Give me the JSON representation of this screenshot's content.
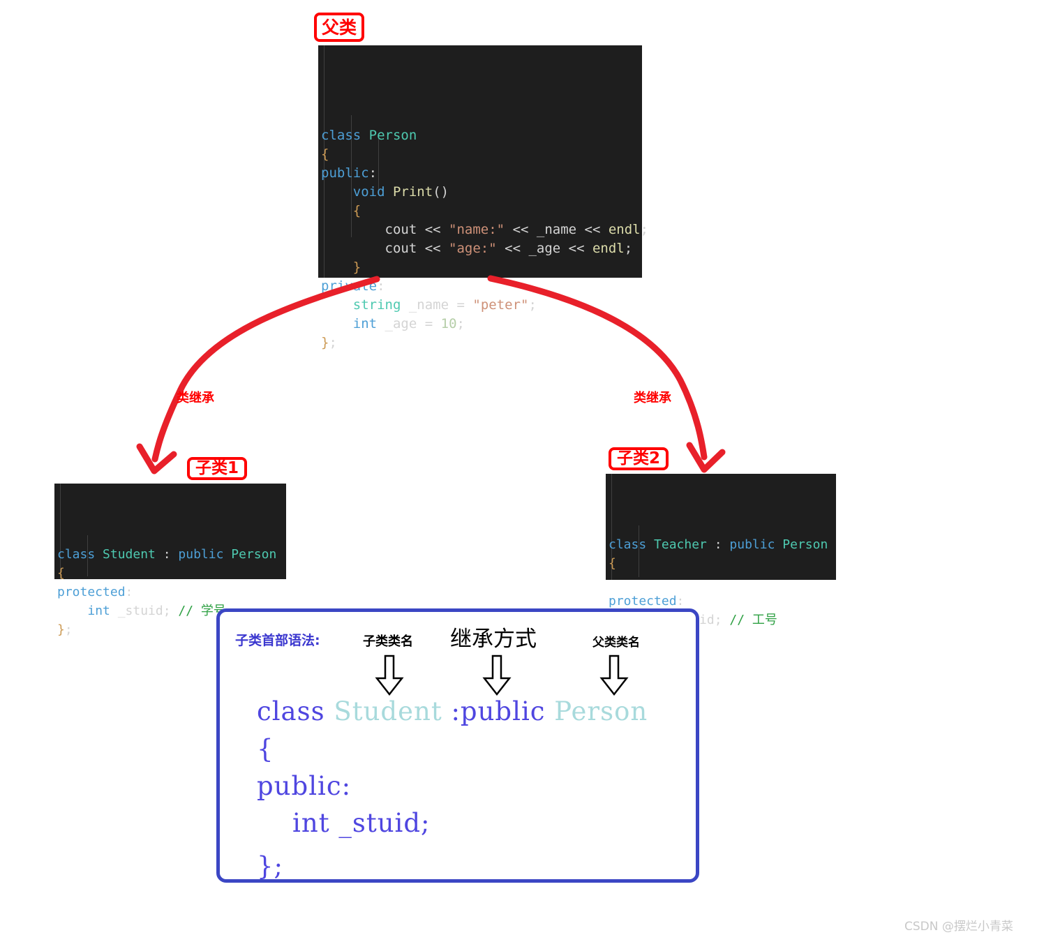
{
  "badges": {
    "parent": "父类",
    "child1": "子类1",
    "child2": "子类2"
  },
  "arrow_labels": {
    "left": "类继承",
    "right": "类继承"
  },
  "parent_code": {
    "title": "class Person",
    "lines": [
      [
        {
          "t": "class",
          "c": "kw"
        },
        {
          "t": " ",
          "c": "punc"
        },
        {
          "t": "Person",
          "c": "type"
        }
      ],
      [
        {
          "t": "{",
          "c": "brace"
        }
      ],
      [
        {
          "t": "public",
          "c": "kw"
        },
        {
          "t": ":",
          "c": "punc"
        }
      ],
      [
        {
          "t": "    ",
          "c": "punc"
        },
        {
          "t": "void",
          "c": "kw"
        },
        {
          "t": " ",
          "c": "punc"
        },
        {
          "t": "Print",
          "c": "fn"
        },
        {
          "t": "()",
          "c": "punc"
        }
      ],
      [
        {
          "t": "    ",
          "c": "punc"
        },
        {
          "t": "{",
          "c": "brace"
        }
      ],
      [
        {
          "t": "        ",
          "c": "punc"
        },
        {
          "t": "cout",
          "c": "punc"
        },
        {
          "t": " << ",
          "c": "op"
        },
        {
          "t": "\"name:\"",
          "c": "str"
        },
        {
          "t": " << ",
          "c": "op"
        },
        {
          "t": "_name",
          "c": "punc"
        },
        {
          "t": " << ",
          "c": "op"
        },
        {
          "t": "endl",
          "c": "fn"
        },
        {
          "t": ";",
          "c": "punc"
        }
      ],
      [
        {
          "t": "        ",
          "c": "punc"
        },
        {
          "t": "cout",
          "c": "punc"
        },
        {
          "t": " << ",
          "c": "op"
        },
        {
          "t": "\"age:\"",
          "c": "str"
        },
        {
          "t": " << ",
          "c": "op"
        },
        {
          "t": "_age",
          "c": "punc"
        },
        {
          "t": " << ",
          "c": "op"
        },
        {
          "t": "endl",
          "c": "fn"
        },
        {
          "t": ";",
          "c": "punc"
        }
      ],
      [
        {
          "t": "    ",
          "c": "punc"
        },
        {
          "t": "}",
          "c": "brace"
        }
      ],
      [
        {
          "t": "private",
          "c": "kw"
        },
        {
          "t": ":",
          "c": "punc"
        }
      ],
      [
        {
          "t": "    ",
          "c": "punc"
        },
        {
          "t": "string",
          "c": "type"
        },
        {
          "t": " _name ",
          "c": "punc"
        },
        {
          "t": "=",
          "c": "op"
        },
        {
          "t": " ",
          "c": "punc"
        },
        {
          "t": "\"peter\"",
          "c": "str"
        },
        {
          "t": ";",
          "c": "punc"
        }
      ],
      [
        {
          "t": "    ",
          "c": "punc"
        },
        {
          "t": "int",
          "c": "kw"
        },
        {
          "t": " _age ",
          "c": "punc"
        },
        {
          "t": "=",
          "c": "op"
        },
        {
          "t": " ",
          "c": "punc"
        },
        {
          "t": "10",
          "c": "num"
        },
        {
          "t": ";",
          "c": "punc"
        }
      ],
      [
        {
          "t": "}",
          "c": "brace"
        },
        {
          "t": ";",
          "c": "punc"
        }
      ]
    ]
  },
  "student_code": {
    "title": "class Student : public Person",
    "lines": [
      [
        {
          "t": "class",
          "c": "kw"
        },
        {
          "t": " ",
          "c": "punc"
        },
        {
          "t": "Student",
          "c": "type"
        },
        {
          "t": " : ",
          "c": "punc"
        },
        {
          "t": "public",
          "c": "kw"
        },
        {
          "t": " ",
          "c": "punc"
        },
        {
          "t": "Person",
          "c": "type"
        }
      ],
      [
        {
          "t": "{",
          "c": "brace"
        }
      ],
      [
        {
          "t": "protected",
          "c": "kw"
        },
        {
          "t": ":",
          "c": "punc"
        }
      ],
      [
        {
          "t": "    ",
          "c": "punc"
        },
        {
          "t": "int",
          "c": "kw"
        },
        {
          "t": " _stuid; ",
          "c": "punc"
        },
        {
          "t": "// 学号",
          "c": "cmt"
        }
      ],
      [
        {
          "t": "}",
          "c": "brace"
        },
        {
          "t": ";",
          "c": "punc"
        }
      ]
    ]
  },
  "teacher_code": {
    "title": "class Teacher : public Person",
    "lines": [
      [
        {
          "t": "class",
          "c": "kw"
        },
        {
          "t": " ",
          "c": "punc"
        },
        {
          "t": "Teacher",
          "c": "type"
        },
        {
          "t": " : ",
          "c": "punc"
        },
        {
          "t": "public",
          "c": "kw"
        },
        {
          "t": " ",
          "c": "punc"
        },
        {
          "t": "Person",
          "c": "type"
        }
      ],
      [
        {
          "t": "{",
          "c": "brace"
        }
      ],
      [
        {
          "t": "",
          "c": "punc"
        }
      ],
      [
        {
          "t": "protected",
          "c": "kw"
        },
        {
          "t": ":",
          "c": "punc"
        }
      ],
      [
        {
          "t": "    ",
          "c": "punc"
        },
        {
          "t": "int",
          "c": "kw"
        },
        {
          "t": " _jobid; ",
          "c": "punc"
        },
        {
          "t": "// 工号",
          "c": "cmt"
        }
      ],
      [
        {
          "t": "}",
          "c": "brace"
        },
        {
          "t": ";",
          "c": "punc"
        }
      ]
    ]
  },
  "syntax_box": {
    "title": "子类首部语法:",
    "callout_subclass_name": "子类类名",
    "callout_inherit_mode": "继承方式",
    "callout_superclass_name": "父类类名",
    "code_lines": [
      [
        {
          "t": "class",
          "c": "bc-blue"
        },
        {
          "t": " ",
          "c": "bc-blue"
        },
        {
          "t": "Student",
          "c": "bc-teal"
        },
        {
          "t": " :",
          "c": "bc-blue"
        },
        {
          "t": "public",
          "c": "bc-blue"
        },
        {
          "t": " ",
          "c": "bc-blue"
        },
        {
          "t": "Person",
          "c": "bc-teal"
        }
      ],
      [
        {
          "t": "{",
          "c": "bc-blue"
        }
      ],
      [
        {
          "t": "public",
          "c": "bc-blue"
        },
        {
          "t": ":",
          "c": "bc-blue"
        }
      ],
      [
        {
          "t": "    ",
          "c": "bc-blue"
        },
        {
          "t": "int",
          "c": "bc-blue"
        },
        {
          "t": " _stuid;",
          "c": "bc-blue"
        }
      ],
      [
        {
          "t": "}",
          "c": "bc-blue"
        },
        {
          "t": ";",
          "c": "bc-blue"
        }
      ]
    ]
  },
  "watermark": "CSDN @摆烂小青菜",
  "colors": {
    "accent_red": "#ff0000",
    "accent_blue": "#3b46c4",
    "code_bg": "#1e1e1e",
    "keyword": "#4d9fd6",
    "type": "#4ec9b0",
    "string": "#ce9178",
    "comment": "#2ea043",
    "function": "#dcdcaa",
    "number": "#b5cea8"
  }
}
